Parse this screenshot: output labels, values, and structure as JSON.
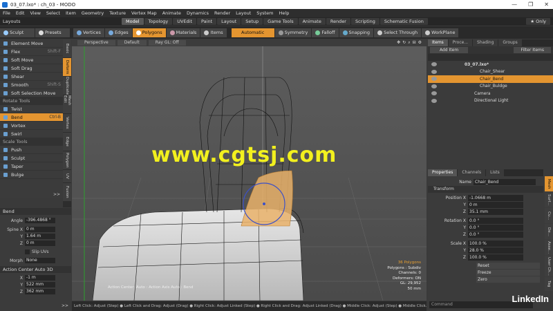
{
  "window": {
    "title": "03_07.lxo* : ch_03 - MODO",
    "min": "—",
    "max": "❐",
    "close": "✕"
  },
  "menu": [
    "File",
    "Edit",
    "View",
    "Select",
    "Item",
    "Geometry",
    "Texture",
    "Vertex Map",
    "Animate",
    "Dynamics",
    "Render",
    "Layout",
    "System",
    "Help"
  ],
  "layouts": {
    "label": "Layouts",
    "tabs": [
      "Model",
      "Topology",
      "UVEdit",
      "Paint",
      "Layout",
      "Setup",
      "Game Tools",
      "Animate",
      "Render",
      "Scripting",
      "Schematic Fusion"
    ],
    "active": "Model",
    "only": "Only"
  },
  "toolbar": {
    "sculpt": "Sculpt",
    "presets": "Presets",
    "modes": [
      "Vertices",
      "Edges",
      "Polygons",
      "Materials",
      "Items"
    ],
    "active_mode": "Polygons",
    "automatic": "Automatic",
    "symmetry": "Symmetry",
    "falloff": "Falloff",
    "snapping": "Snapping",
    "select_through": "Select Through",
    "workplane": "WorkPlane"
  },
  "tools": {
    "deform": [
      {
        "label": "Element Move",
        "key": ""
      },
      {
        "label": "Flex",
        "key": "Shift-F"
      },
      {
        "label": "Soft Move",
        "key": ""
      },
      {
        "label": "Soft Drag",
        "key": ""
      },
      {
        "label": "Shear",
        "key": ""
      },
      {
        "label": "Smooth",
        "key": "Shift-S"
      },
      {
        "label": "Soft Selection Move",
        "key": ""
      }
    ],
    "rotate_header": "Rotate Tools",
    "rotate": [
      {
        "label": "Twist",
        "key": ""
      },
      {
        "label": "Bend",
        "key": "Ctrl-B"
      },
      {
        "label": "Vortex",
        "key": ""
      },
      {
        "label": "Swirl",
        "key": ""
      }
    ],
    "scale_header": "Scale Tools",
    "scale": [
      {
        "label": "Push",
        "key": ""
      },
      {
        "label": "Sculpt",
        "key": ""
      },
      {
        "label": "Taper",
        "key": ""
      },
      {
        "label": "Bulge",
        "key": ""
      }
    ],
    "selected": "Bend",
    "vtabs": [
      "Basic",
      "Deform",
      "Duplicate",
      "Mesh Edit",
      "Vertex",
      "Edge",
      "Polygon",
      "UV",
      "Fusion"
    ],
    "vtab_active": "Deform"
  },
  "bend": {
    "title": "Bend",
    "angle_label": "Angle",
    "angle": "-396.4868 °",
    "spine_label": "Spine X",
    "spine_x": "0 m",
    "spine_y": "1.64 m",
    "spine_z": "0 m",
    "y_label": "Y",
    "z_label": "Z",
    "x_label": "X",
    "slip_uvs": "Slip UVs",
    "morph_label": "Morph",
    "morph": "None",
    "action_center": "Action Center Auto 3D",
    "ac_x": "-1 m",
    "ac_y": "522 mm",
    "ac_z": "362 mm",
    "expand": ">>"
  },
  "viewport": {
    "perspective": "Perspective",
    "default": "Default",
    "raygl": "Ray GL: Off",
    "watermark": "www.cgtsj.com",
    "info": [
      "36 Polygons",
      "Polygons : Subdiv",
      "Channels: 0",
      "Deformers: ON",
      "GL: 29,952",
      "50 mm"
    ],
    "action_label": "Action Center: Auto : Action Axis Auto : Bend"
  },
  "status": "Left Click: Adjust (Step) ● Left Click and Drag: Adjust (Drag) ● Right Click: Adjust Linked (Step) ● Right Click and Drag: Adjust Linked (Drag) ● Middle Click: Adjust (Step) ● Middle Click...",
  "items_panel": {
    "tabs": [
      "Items",
      "Proce...",
      "Shading",
      "Groups"
    ],
    "add_item": "Add Item",
    "filter": "Filter Items",
    "rows": [
      "03_07.lxo*",
      "Chair_Shear",
      "Chair_Bend",
      "Chair_Buldge",
      "Camera",
      "Directional Light"
    ],
    "selected": "Chair_Bend"
  },
  "properties": {
    "tabs": [
      "Properties",
      "Channels",
      "Lists"
    ],
    "name_label": "Name",
    "name": "Chair_Bend",
    "transform": "Transform",
    "pos_label": "Position X",
    "pos_x": "-1.0668 m",
    "pos_y": "0 m",
    "pos_z": "35.1 mm",
    "rot_label": "Rotation X",
    "rot_x": "0.0 °",
    "rot_y": "0.0 °",
    "rot_z": "0.0 °",
    "scale_label": "Scale X",
    "scale_x": "100.0 %",
    "scale_y": "28.0 %",
    "scale_z": "100.0 %",
    "y_label": "Y",
    "z_label": "Z",
    "reset": "Reset",
    "freeze": "Freeze",
    "zero": "Zero",
    "command": "Command",
    "side_tabs": [
      "Mesh",
      "Surf...",
      "Cu...",
      "De...",
      "Asse...",
      "User Ch...",
      "Tag"
    ]
  },
  "brand": "LinkedIn",
  "colors": {
    "accent": "#e49530",
    "select_blue": "#3b50c8",
    "watermark": "#f2f01e"
  }
}
